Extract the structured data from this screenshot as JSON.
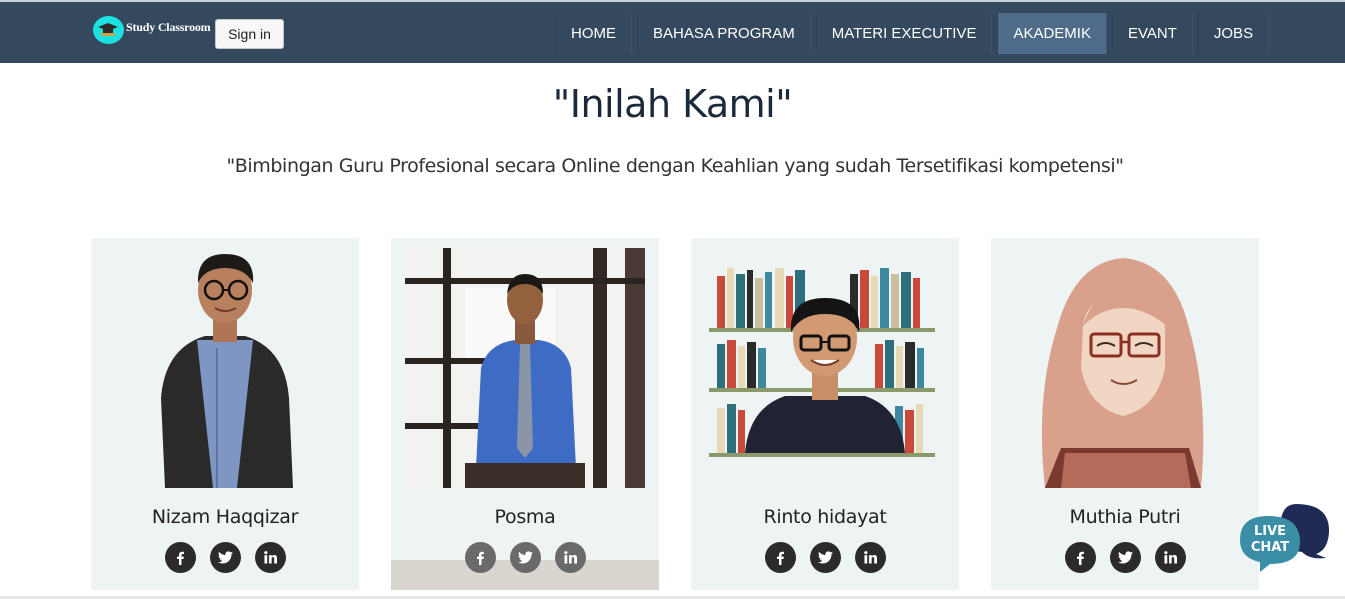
{
  "navbar": {
    "logo_text": "Study Classroom",
    "signin_label": "Sign in",
    "menu": [
      {
        "label": "HOME",
        "active": false
      },
      {
        "label": "BAHASA PROGRAM",
        "active": false
      },
      {
        "label": "MATERI EXECUTIVE",
        "active": false
      },
      {
        "label": "AKADEMIK",
        "active": true
      },
      {
        "label": "EVANT",
        "active": false
      },
      {
        "label": "JOBS",
        "active": false
      }
    ]
  },
  "header": {
    "title": "\"Inilah Kami\"",
    "subtitle": "\"Bimbingan Guru Profesional secara Online dengan Keahlian yang sudah Tersetifikasi kompetensi\""
  },
  "team": [
    {
      "name": "Nizam Haqqizar"
    },
    {
      "name": "Posma"
    },
    {
      "name": "Rinto hidayat"
    },
    {
      "name": "Muthia Putri"
    }
  ],
  "livechat": {
    "line1": "LIVE",
    "line2": "CHAT"
  },
  "colors": {
    "navbar_bg": "#34495e",
    "nav_active_bg": "#4e6c8a",
    "card_bg": "#eef3f3",
    "livechat_front": "#3a8ea6",
    "livechat_back": "#1f2a55"
  }
}
